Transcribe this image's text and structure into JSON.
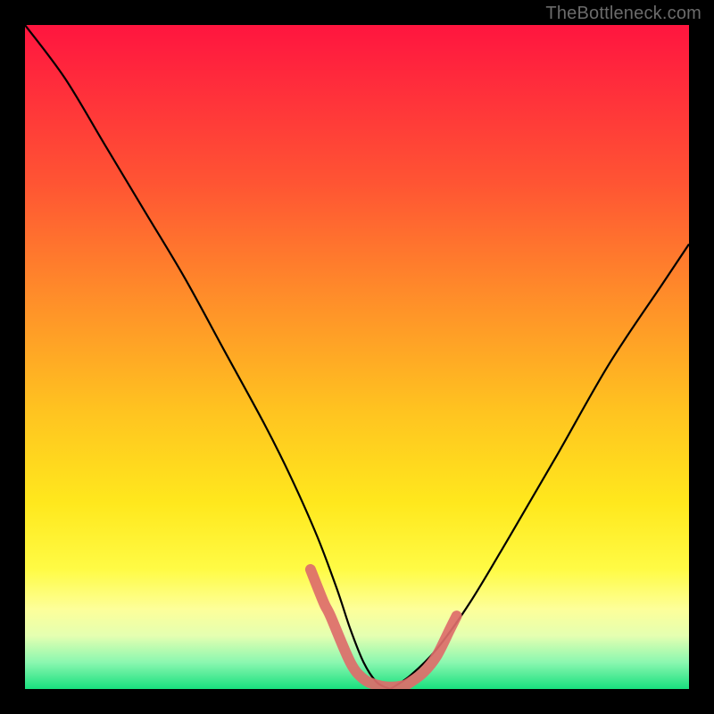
{
  "watermark": {
    "text": "TheBottleneck.com"
  },
  "chart_data": {
    "type": "line",
    "title": "",
    "xlabel": "",
    "ylabel": "",
    "xlim": [
      0,
      100
    ],
    "ylim": [
      0,
      100
    ],
    "grid": false,
    "background": {
      "gradient": "vertical",
      "stops": [
        {
          "pos": 0,
          "color": "#ff153f"
        },
        {
          "pos": 24,
          "color": "#ff5533"
        },
        {
          "pos": 58,
          "color": "#ffc320"
        },
        {
          "pos": 82,
          "color": "#fffb45"
        },
        {
          "pos": 100,
          "color": "#18e07e"
        }
      ]
    },
    "series": [
      {
        "name": "left-curve",
        "x": [
          0,
          6,
          12,
          18,
          24,
          30,
          36,
          40,
          44,
          47,
          49,
          51,
          53,
          55
        ],
        "values": [
          100,
          92,
          82,
          72,
          62,
          51,
          40,
          32,
          23,
          15,
          9,
          4,
          1,
          0
        ]
      },
      {
        "name": "right-curve",
        "x": [
          55,
          58,
          62,
          67,
          73,
          80,
          88,
          96,
          100
        ],
        "values": [
          0,
          2,
          6,
          13,
          23,
          35,
          49,
          61,
          67
        ]
      }
    ],
    "annotations": [
      {
        "name": "bottleneck-band",
        "type": "region-along-curve",
        "color": "#dd6d6a",
        "points": [
          {
            "x": 43,
            "y": 18
          },
          {
            "x": 45,
            "y": 13
          },
          {
            "x": 46,
            "y": 11
          },
          {
            "x": 49,
            "y": 4
          },
          {
            "x": 51,
            "y": 1.5
          },
          {
            "x": 53,
            "y": 0.6
          },
          {
            "x": 55,
            "y": 0.3
          },
          {
            "x": 57,
            "y": 0.5
          },
          {
            "x": 58,
            "y": 1
          },
          {
            "x": 60,
            "y": 2.5
          },
          {
            "x": 62,
            "y": 5
          },
          {
            "x": 64,
            "y": 9
          },
          {
            "x": 65,
            "y": 11
          }
        ]
      }
    ]
  }
}
